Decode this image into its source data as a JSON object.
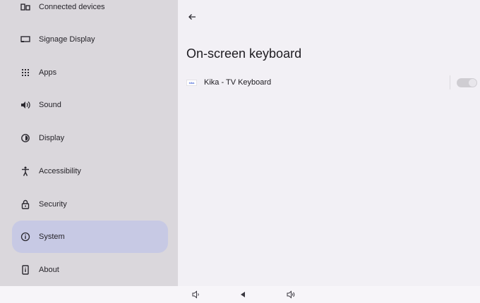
{
  "sidebar": {
    "items": [
      {
        "label": "Connected devices",
        "icon": "devices-icon",
        "active": false
      },
      {
        "label": "Signage Display",
        "icon": "display-icon",
        "active": false
      },
      {
        "label": "Apps",
        "icon": "apps-grid-icon",
        "active": false
      },
      {
        "label": "Sound",
        "icon": "volume-icon",
        "active": false
      },
      {
        "label": "Display",
        "icon": "brightness-icon",
        "active": false
      },
      {
        "label": "Accessibility",
        "icon": "accessibility-icon",
        "active": false
      },
      {
        "label": "Security",
        "icon": "lock-icon",
        "active": false
      },
      {
        "label": "System",
        "icon": "info-icon",
        "active": true
      },
      {
        "label": "About",
        "icon": "phone-info-icon",
        "active": false
      }
    ]
  },
  "main": {
    "back_icon": "arrow-back-icon",
    "title": "On-screen keyboard",
    "keyboards": [
      {
        "logo_text": "kika",
        "label": "Kika - TV Keyboard",
        "enabled": true,
        "toggle_disabled": true
      }
    ]
  },
  "navbar": {
    "buttons": [
      "volume-down-icon",
      "back-triangle-icon",
      "volume-up-icon"
    ]
  },
  "colors": {
    "sidebar_bg": "#dad7dc",
    "active_item_bg": "#c7c9e4",
    "main_bg": "#f2f0f5",
    "text": "#1d1b20"
  }
}
